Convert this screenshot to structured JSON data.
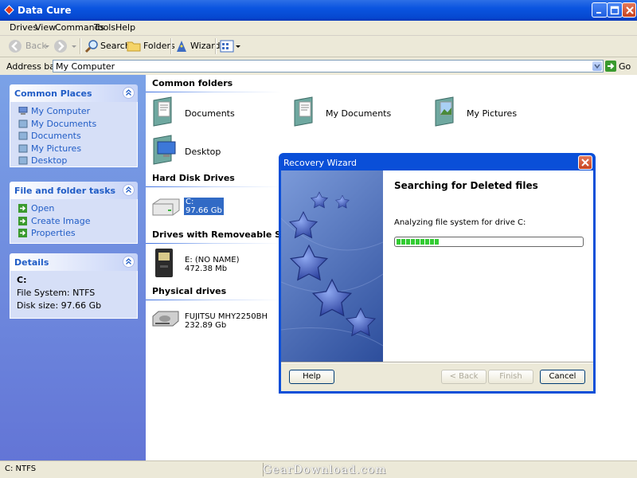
{
  "window": {
    "title": "Data Cure"
  },
  "menu": [
    "Drives",
    "View",
    "Commands",
    "Tools",
    "Help"
  ],
  "toolbar": {
    "back": "Back",
    "search": "Search",
    "folders": "Folders",
    "wizard": "Wizard"
  },
  "address": {
    "label": "Address bar:",
    "value": "My Computer",
    "go": "Go"
  },
  "sidebar": {
    "common_places": {
      "title": "Common Places",
      "items": [
        "My Computer",
        "My Documents",
        "Documents",
        "My Pictures",
        "Desktop"
      ]
    },
    "file_tasks": {
      "title": "File and folder tasks",
      "items": [
        "Open",
        "Create Image",
        "Properties"
      ]
    },
    "details": {
      "title": "Details",
      "name": "C:",
      "filesystem": "File System: NTFS",
      "disksize": "Disk size: 97.66 Gb"
    }
  },
  "content": {
    "common_folders": {
      "title": "Common folders",
      "items": [
        "Documents",
        "My Documents",
        "My Pictures",
        "Desktop"
      ]
    },
    "hard_disks": {
      "title": "Hard Disk Drives",
      "items": [
        {
          "name": "C:",
          "size": "97.66 Gb",
          "selected": true
        }
      ]
    },
    "removable": {
      "title": "Drives with Removeable Storage",
      "items": [
        {
          "name": "E: (NO NAME)",
          "size": "472.38 Mb"
        }
      ]
    },
    "physical": {
      "title": "Physical drives",
      "items": [
        {
          "name": "FUJITSU MHY2250BH",
          "size": "232.89 Gb"
        }
      ]
    }
  },
  "dialog": {
    "title": "Recovery Wizard",
    "heading": "Searching for Deleted files",
    "status": "Analyzing file system for drive C:",
    "progress_segments": 9,
    "buttons": {
      "help": "Help",
      "back": "< Back",
      "finish": "Finish",
      "cancel": "Cancel"
    }
  },
  "statusbar": {
    "text": "C: NTFS",
    "watermark": "GearDownload.com"
  },
  "colors": {
    "title_blue": "#0a54e0",
    "link_blue": "#215dc6",
    "pane_blue": "#7ba2e7",
    "progress_green": "#33cc33"
  }
}
